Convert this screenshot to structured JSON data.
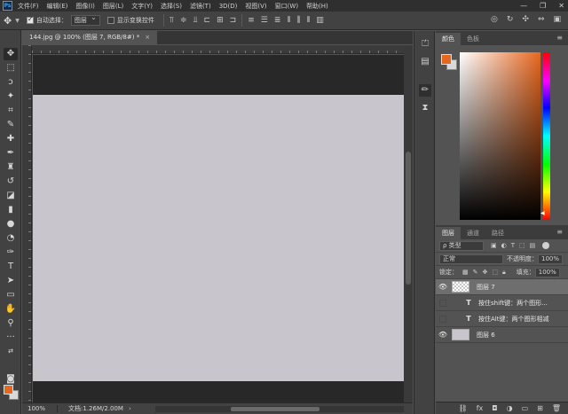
{
  "menu": {
    "logo": "Ps",
    "items": [
      "文件(F)",
      "编辑(E)",
      "图像(I)",
      "图层(L)",
      "文字(Y)",
      "选择(S)",
      "滤镜(T)",
      "3D(D)",
      "视图(V)",
      "窗口(W)",
      "帮助(H)"
    ],
    "minimize": "—",
    "maximize": "❐",
    "close": "✕"
  },
  "options": {
    "auto_select_label": "自动选择：",
    "auto_select_value": "图层",
    "transform_label": "显示变换控件"
  },
  "document": {
    "tab_title": "144.jpg @ 100% (图层 7, RGB/8#) *",
    "close": "×",
    "zoom": "100%",
    "doc_size": "文档:1.26M/2.00M",
    "status_arrow": "›"
  },
  "color_panel": {
    "tabs": [
      "颜色",
      "色板"
    ],
    "foreground": "#e8671f",
    "background": "#d9d9d9"
  },
  "layers_panel": {
    "tabs": [
      "图层",
      "通道",
      "路径"
    ],
    "filter_kind": "ρ 类型",
    "blend_mode": "正常",
    "opacity_label": "不透明度：",
    "opacity_value": "100%",
    "lock_label": "锁定：",
    "fill_label": "填充：",
    "fill_value": "100%",
    "layers": [
      {
        "name": "图层 7",
        "type": "pixel",
        "visible": true,
        "selected": true
      },
      {
        "name": "按住shift键：两个图形...",
        "type": "text",
        "visible": false,
        "selected": false
      },
      {
        "name": "按住Alt键：两个图形相减",
        "type": "text",
        "visible": false,
        "selected": false
      },
      {
        "name": "图层 6",
        "type": "pixel",
        "visible": true,
        "selected": false
      }
    ],
    "footer_icons": [
      "link-icon",
      "fx-icon",
      "mask-icon",
      "adjustment-icon",
      "group-icon",
      "new-layer-icon",
      "trash-icon"
    ]
  }
}
